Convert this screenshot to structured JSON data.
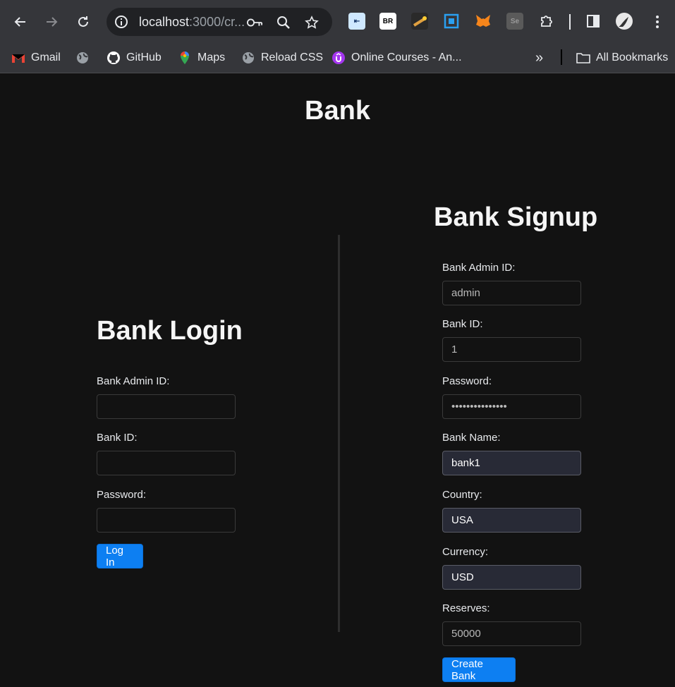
{
  "browser": {
    "url_host": "localhost",
    "url_rest": ":3000/cr...",
    "bookmarks": [
      {
        "label": "Gmail",
        "icon": "gmail-icon"
      },
      {
        "label": "",
        "icon": "globe-icon"
      },
      {
        "label": "GitHub",
        "icon": "github-icon"
      },
      {
        "label": "Maps",
        "icon": "maps-icon"
      },
      {
        "label": "Reload CSS",
        "icon": "globe-icon"
      },
      {
        "label": "Online Courses - An...",
        "icon": "udemy-icon"
      }
    ],
    "more_label": "»",
    "all_bookmarks": "All Bookmarks",
    "extensions": [
      {
        "icon": "ext-login-icon",
        "text": "⇤"
      },
      {
        "icon": "ext-br-icon",
        "text": "BR"
      },
      {
        "icon": "ext-torch-icon",
        "text": ""
      },
      {
        "icon": "ext-screenshot-icon",
        "text": ""
      },
      {
        "icon": "metamask-fox-icon",
        "text": ""
      },
      {
        "icon": "selenium-icon",
        "text": "Se"
      }
    ]
  },
  "page": {
    "title": "Bank"
  },
  "login": {
    "title": "Bank Login",
    "admin_label": "Bank Admin ID:",
    "admin_value": "",
    "bank_id_label": "Bank ID:",
    "bank_id_value": "",
    "password_label": "Password:",
    "password_value": "",
    "button": "Log In"
  },
  "signup": {
    "title": "Bank Signup",
    "admin_label": "Bank Admin ID:",
    "admin_value": "admin",
    "bank_id_label": "Bank ID:",
    "bank_id_value": "1",
    "password_label": "Password:",
    "password_value": "•••••••••••••••",
    "name_label": "Bank Name:",
    "name_value": "bank1",
    "country_label": "Country:",
    "country_value": "USA",
    "currency_label": "Currency:",
    "currency_value": "USD",
    "reserves_label": "Reserves:",
    "reserves_value": "50000",
    "button": "Create Bank"
  },
  "colors": {
    "background": "#121212",
    "accent": "#0d7ff2",
    "filled_input": "#282a36"
  }
}
